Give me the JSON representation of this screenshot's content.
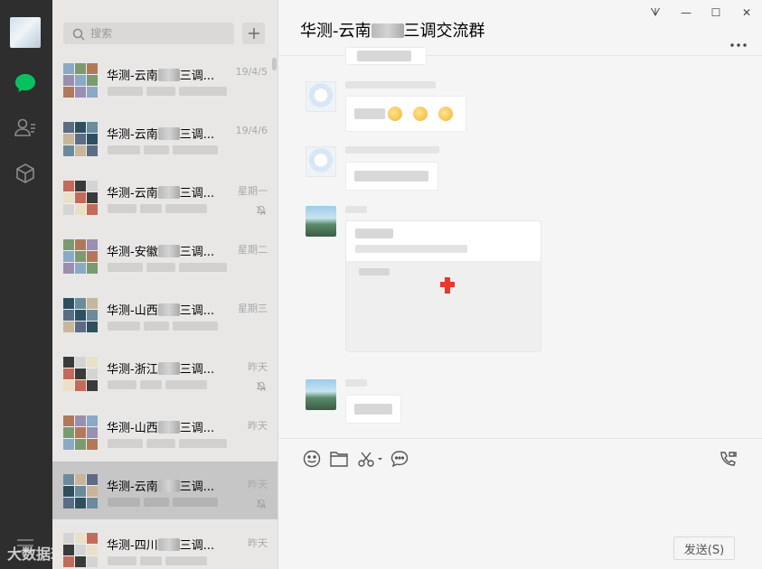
{
  "search": {
    "placeholder": "搜索"
  },
  "conversations": [
    {
      "name": "华测-云南",
      "suffix": "三调...",
      "time": "19/4/5",
      "muted": false
    },
    {
      "name": "华测-云南",
      "suffix": "三调...",
      "time": "19/4/6",
      "muted": false
    },
    {
      "name": "华测-云南",
      "suffix": "三调...",
      "time": "星期一",
      "muted": true
    },
    {
      "name": "华测-安徽",
      "suffix": "三调...",
      "time": "星期二",
      "muted": false
    },
    {
      "name": "华测-山西",
      "suffix": "三调...",
      "time": "星期三",
      "muted": false
    },
    {
      "name": "华测-浙江",
      "suffix": "三调...",
      "time": "昨天",
      "muted": true
    },
    {
      "name": "华测-山西",
      "suffix": "三调...",
      "time": "昨天",
      "muted": false
    },
    {
      "name": "华测-云南",
      "suffix": "三调...",
      "time": "昨天",
      "muted": true,
      "selected": true
    },
    {
      "name": "华测-四川",
      "suffix": "三调...",
      "time": "昨天",
      "muted": false
    }
  ],
  "chat": {
    "title_prefix": "华测-云南",
    "title_suffix": "三调交流群",
    "more": "⋯"
  },
  "window": {
    "pin": "ᗐ",
    "minimize": "—",
    "maximize": "☐",
    "close": "✕"
  },
  "input": {
    "send_label": "发送(S)"
  },
  "watermark": "大数据玩",
  "colors": {
    "rail": "#2e2e2e",
    "list": "#e8e7e6",
    "selected": "#c6c6c6",
    "chat_bg": "#f5f5f5",
    "accent_green": "#07c160",
    "pin_red": "#e8392e"
  }
}
